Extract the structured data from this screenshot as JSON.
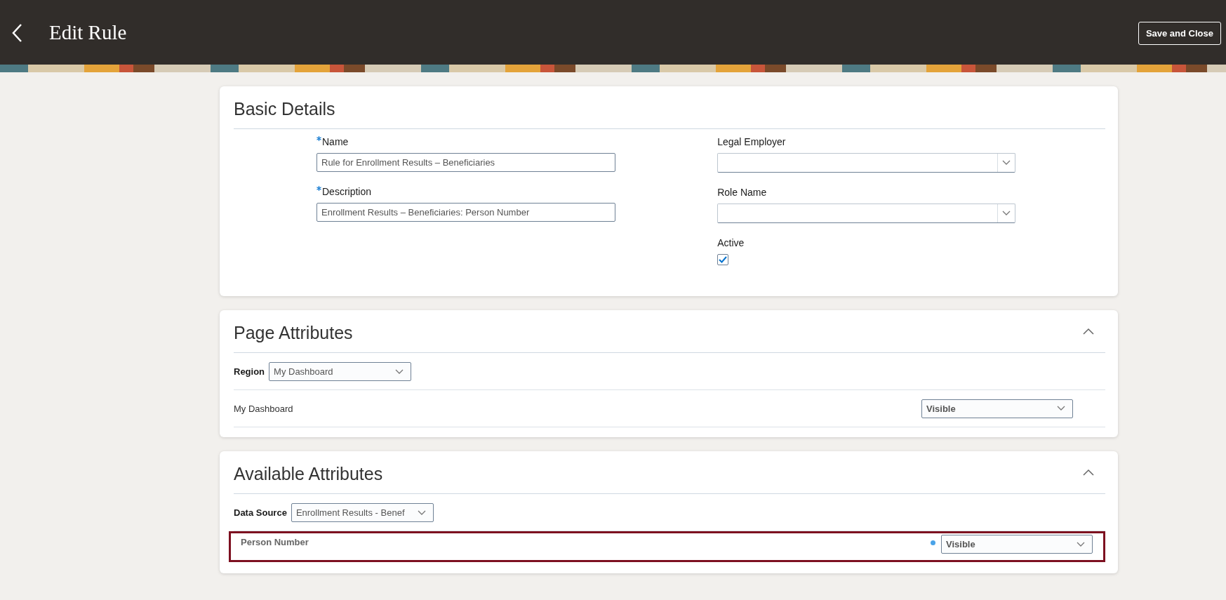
{
  "header": {
    "title": "Edit Rule",
    "button": "Save and Close"
  },
  "basic_details": {
    "title": "Basic Details",
    "left_fields": [
      {
        "label": "Name",
        "required": true,
        "value": "Rule for Enrollment Results – Beneficiaries"
      },
      {
        "label": "Description",
        "required": true,
        "value": "Enrollment Results – Beneficiaries: Person Number"
      }
    ],
    "right_fields": [
      {
        "label": "Legal Employer"
      },
      {
        "label": "Role Name"
      }
    ],
    "active": {
      "label": "Active",
      "checked": true
    }
  },
  "page_attributes": {
    "title": "Page Attributes",
    "expanded": true,
    "filter_label": "Region",
    "filter_value": "My Dashboard",
    "rows": [
      {
        "name": "My Dashboard",
        "value": "Visible",
        "highlighted": false,
        "changed": false
      }
    ]
  },
  "available_attributes": {
    "title": "Available Attributes",
    "expanded": true,
    "filter_label": "Data Source",
    "filter_value": "Enrollment Results - Benef",
    "rows": [
      {
        "name": "Person Number",
        "value": "Visible",
        "highlighted": true,
        "changed": true
      }
    ]
  }
}
